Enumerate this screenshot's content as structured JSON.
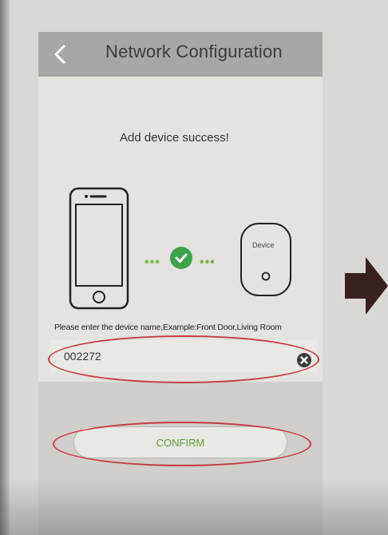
{
  "header": {
    "title": "Network Configuration",
    "back_icon": "chevron-left-icon"
  },
  "content": {
    "success_message": "Add device success!",
    "device_label": "Device",
    "dots": "•••",
    "hint": "Please enter the device name,Example:Front Door,Living Room",
    "device_name_value": "002272",
    "clear_icon": "clear-x-icon"
  },
  "actions": {
    "confirm_label": "CONFIRM"
  },
  "colors": {
    "accent_green": "#3da34a",
    "annotation_red": "#c83a44",
    "header_gray": "#a8a7a7"
  }
}
